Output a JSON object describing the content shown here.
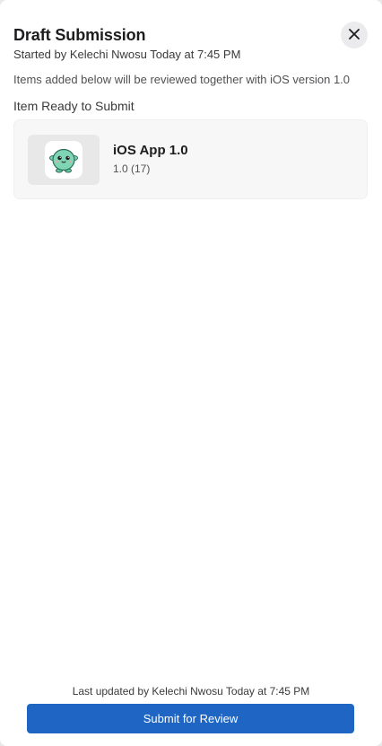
{
  "header": {
    "title": "Draft Submission",
    "subtitle": "Started by Kelechi Nwosu Today at 7:45 PM",
    "close_icon": "close-icon"
  },
  "description": "Items added below will be reviewed together with iOS version 1.0",
  "section": {
    "label": "Item Ready to Submit",
    "items": [
      {
        "icon": "app-mascot-icon",
        "name": "iOS App 1.0",
        "version": "1.0 (17)"
      }
    ]
  },
  "footer": {
    "last_updated": "Last updated by Kelechi Nwosu Today at 7:45 PM",
    "submit_label": "Submit for Review"
  },
  "colors": {
    "accent": "#1f66c4",
    "icon_green": "#7fd6b5"
  }
}
